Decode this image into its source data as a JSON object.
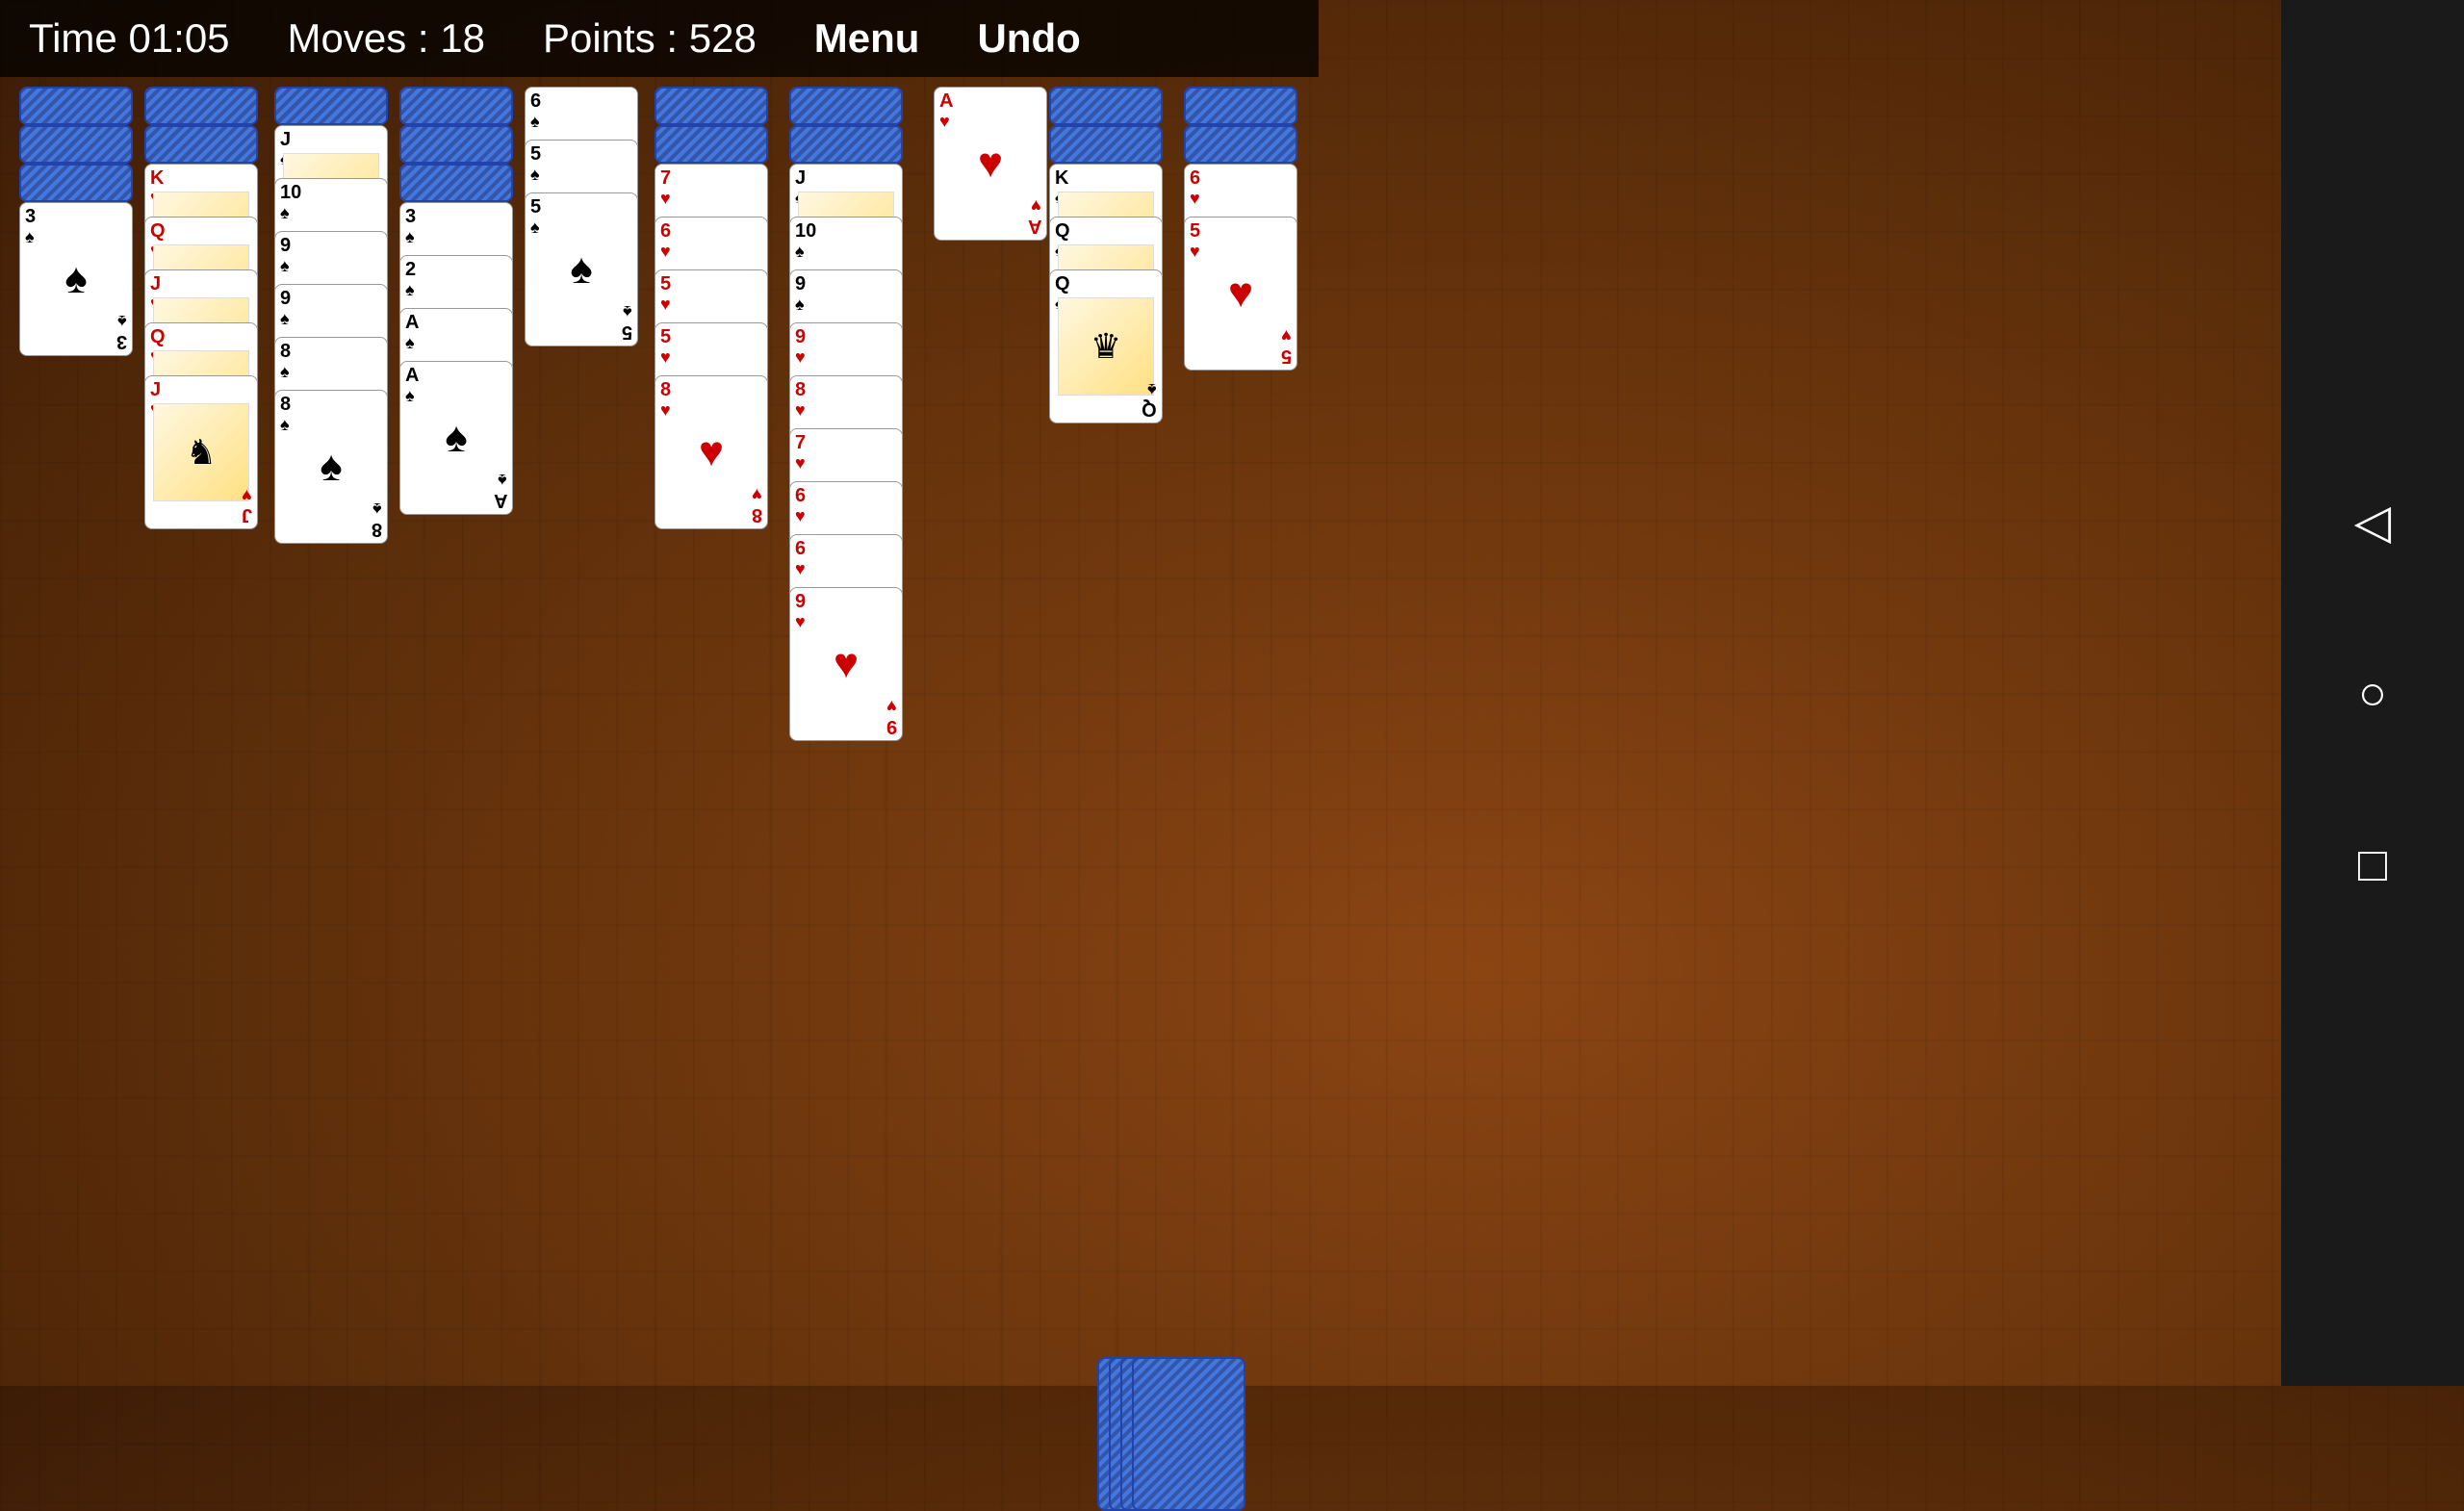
{
  "header": {
    "time_label": "Time 01:05",
    "moves_label": "Moves : 18",
    "points_label": "Points : 528",
    "menu_label": "Menu",
    "undo_label": "Undo"
  },
  "nav": {
    "back_icon": "◁",
    "circle_icon": "○",
    "square_icon": "□"
  },
  "columns": [
    {
      "id": "col1",
      "cards": [
        {
          "type": "back"
        },
        {
          "type": "back"
        },
        {
          "type": "back"
        },
        {
          "rank": "3",
          "suit": "♠",
          "color": "black",
          "type": "face"
        }
      ]
    },
    {
      "id": "col2",
      "cards": [
        {
          "type": "back"
        },
        {
          "type": "back"
        },
        {
          "rank": "K",
          "suit": "♥",
          "color": "red",
          "type": "face",
          "face": true
        },
        {
          "rank": "Q",
          "suit": "♥",
          "color": "red",
          "type": "face",
          "face": true
        },
        {
          "rank": "J",
          "suit": "♥",
          "color": "red",
          "type": "face",
          "face": true
        },
        {
          "rank": "Q",
          "suit": "♥",
          "color": "red",
          "type": "face",
          "face": true
        },
        {
          "rank": "J",
          "suit": "♥",
          "color": "red",
          "type": "face",
          "face": true
        }
      ]
    },
    {
      "id": "col3",
      "cards": [
        {
          "type": "back"
        },
        {
          "rank": "J",
          "suit": "♠",
          "color": "black",
          "type": "face",
          "face": true
        },
        {
          "rank": "10",
          "suit": "♠",
          "color": "black",
          "type": "face"
        },
        {
          "rank": "9",
          "suit": "♠",
          "color": "black",
          "type": "face"
        },
        {
          "rank": "9",
          "suit": "♠",
          "color": "black",
          "type": "face"
        },
        {
          "rank": "8",
          "suit": "♠",
          "color": "black",
          "type": "face"
        },
        {
          "rank": "8",
          "suit": "♠",
          "color": "black",
          "type": "face"
        }
      ]
    },
    {
      "id": "col4",
      "cards": [
        {
          "type": "back"
        },
        {
          "type": "back"
        },
        {
          "type": "back"
        },
        {
          "rank": "3",
          "suit": "♠",
          "color": "black",
          "type": "face"
        },
        {
          "rank": "2",
          "suit": "♠",
          "color": "black",
          "type": "face"
        },
        {
          "rank": "A",
          "suit": "♠",
          "color": "black",
          "type": "face"
        },
        {
          "rank": "A",
          "suit": "♠",
          "color": "black",
          "type": "face"
        }
      ]
    },
    {
      "id": "col5",
      "cards": [
        {
          "rank": "6",
          "suit": "♠",
          "color": "black",
          "type": "face"
        },
        {
          "rank": "5",
          "suit": "♠",
          "color": "black",
          "type": "face"
        },
        {
          "rank": "5",
          "suit": "♠",
          "color": "black",
          "type": "face"
        }
      ]
    },
    {
      "id": "col6",
      "cards": [
        {
          "type": "back"
        },
        {
          "type": "back"
        },
        {
          "rank": "7",
          "suit": "♥",
          "color": "red",
          "type": "face"
        },
        {
          "rank": "6",
          "suit": "♥",
          "color": "red",
          "type": "face"
        },
        {
          "rank": "5",
          "suit": "♥",
          "color": "red",
          "type": "face"
        },
        {
          "rank": "5",
          "suit": "♥",
          "color": "red",
          "type": "face"
        },
        {
          "rank": "8",
          "suit": "♥",
          "color": "red",
          "type": "face"
        }
      ]
    },
    {
      "id": "col7",
      "cards": [
        {
          "type": "back"
        },
        {
          "type": "back"
        },
        {
          "rank": "J",
          "suit": "♠",
          "color": "black",
          "type": "face",
          "face": true
        },
        {
          "rank": "10",
          "suit": "♠",
          "color": "black",
          "type": "face"
        },
        {
          "rank": "9",
          "suit": "♠",
          "color": "black",
          "type": "face"
        },
        {
          "rank": "9",
          "suit": "♥",
          "color": "red",
          "type": "face"
        },
        {
          "rank": "8",
          "suit": "♥",
          "color": "red",
          "type": "face"
        },
        {
          "rank": "7",
          "suit": "♥",
          "color": "red",
          "type": "face"
        },
        {
          "rank": "6",
          "suit": "♥",
          "color": "red",
          "type": "face"
        },
        {
          "rank": "6",
          "suit": "♥",
          "color": "red",
          "type": "face"
        },
        {
          "rank": "9",
          "suit": "♥",
          "color": "red",
          "type": "face"
        }
      ]
    },
    {
      "id": "col8",
      "cards": [
        {
          "rank": "A",
          "suit": "♥",
          "color": "red",
          "type": "face"
        }
      ]
    },
    {
      "id": "col9",
      "cards": [
        {
          "type": "back"
        },
        {
          "type": "back"
        },
        {
          "rank": "K",
          "suit": "♠",
          "color": "black",
          "type": "face",
          "face": true
        },
        {
          "rank": "Q",
          "suit": "♠",
          "color": "black",
          "type": "face",
          "face": true
        },
        {
          "rank": "Q",
          "suit": "♠",
          "color": "black",
          "type": "face",
          "face": true
        }
      ]
    },
    {
      "id": "col10",
      "cards": [
        {
          "type": "back"
        },
        {
          "type": "back"
        },
        {
          "rank": "6",
          "suit": "♥",
          "color": "red",
          "type": "face"
        },
        {
          "rank": "5",
          "suit": "♥",
          "color": "red",
          "type": "face"
        }
      ]
    }
  ],
  "stock": {
    "count": 4
  }
}
